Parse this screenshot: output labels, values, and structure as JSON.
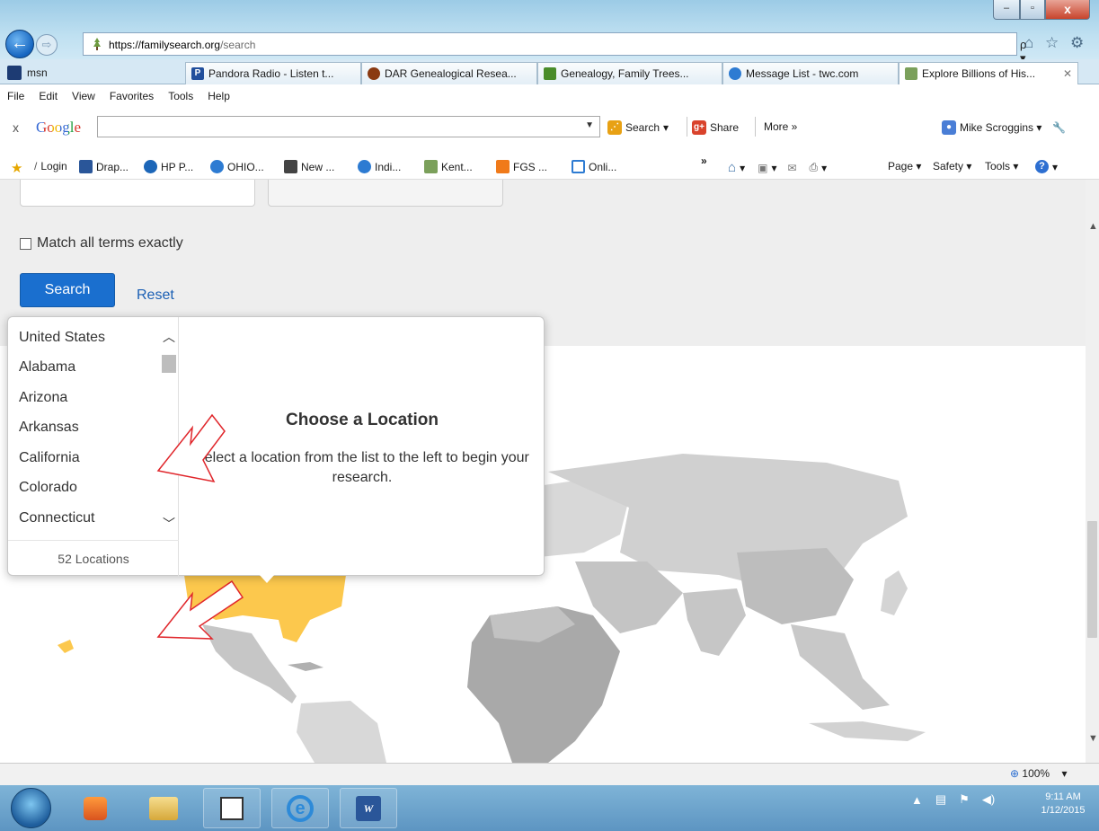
{
  "window": {
    "minimize_glyph": "–",
    "maximize_glyph": "▫",
    "close_glyph": "x"
  },
  "nav": {
    "back_glyph": "←",
    "forward_glyph": "⇨",
    "address_host": "https://familysearch.org",
    "address_path": "/search",
    "address_tools": "ρ ▾ 🔒 c",
    "right_icons": "⌂ ☆ ⚙"
  },
  "tabs": {
    "msn": "msn",
    "items": [
      {
        "label": "Pandora Radio - Listen t...",
        "icon": "pandora-icon",
        "color": "#224f9c"
      },
      {
        "label": "DAR Genealogical Resea...",
        "icon": "dar-icon",
        "color": "#8a3a12"
      },
      {
        "label": "Genealogy, Family Trees...",
        "icon": "tree-icon",
        "color": "#4a8c2a"
      },
      {
        "label": "Message List - twc.com",
        "icon": "ie-icon",
        "color": "#2d7bd2"
      },
      {
        "label": "Explore Billions of His...",
        "icon": "familysearch-icon",
        "color": "#7ba05b",
        "active": true
      }
    ],
    "close_glyph": "✕"
  },
  "menu": [
    "File",
    "Edit",
    "View",
    "Favorites",
    "Tools",
    "Help"
  ],
  "google_toolbar": {
    "close_glyph": "x",
    "logo": "Google",
    "search_value": "",
    "search_label": "Search",
    "share_label": "Share",
    "more_label": "More »",
    "user_label": "Mike Scroggins ▾",
    "colors": {
      "search": "#e8a114",
      "share": "#d9432c"
    }
  },
  "favorites_bar": {
    "items": [
      "Login",
      "Drap...",
      "HP P...",
      "OHIO...",
      "New ...",
      "Indi...",
      "Kent...",
      "FGS ...",
      "Onli..."
    ],
    "overflow": "»",
    "commands": [
      "Page ▾",
      "Safety ▾",
      "Tools ▾"
    ]
  },
  "search_form": {
    "match_label": "Match all terms exactly",
    "search_button": "Search",
    "reset_link": "Reset"
  },
  "location_picker": {
    "locations": [
      "United States",
      "Alabama",
      "Arizona",
      "Arkansas",
      "California",
      "Colorado",
      "Connecticut"
    ],
    "count_label": "52 Locations",
    "heading": "Choose a Location",
    "subtext": "Select a location from the list to the left to begin your research.",
    "selected": "United States"
  },
  "map": {
    "highlight_color": "#fcc84d",
    "land_color": "#c8c8c8",
    "dark_land_color": "#a9a9a9",
    "annotation_arrow_color": "#e0262b"
  },
  "status": {
    "zoom": "100%",
    "zoom_caret": "▾"
  },
  "taskbar": {
    "time": "9:11 AM",
    "date": "1/12/2015",
    "tray_glyphs": [
      "▲",
      "▤",
      "⚑",
      "◀)"
    ]
  }
}
